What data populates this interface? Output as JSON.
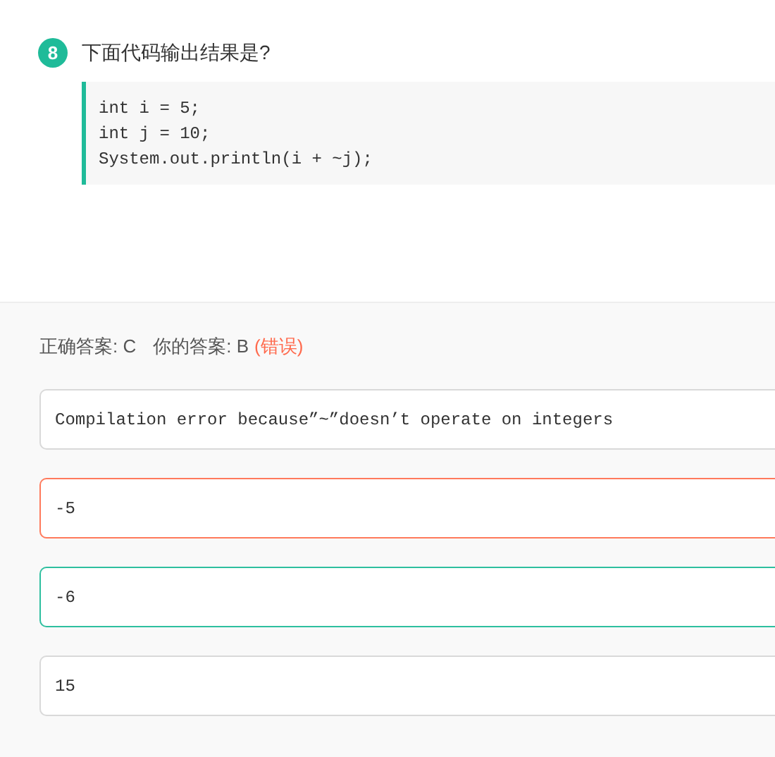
{
  "question": {
    "number": "8",
    "title": "下面代码输出结果是?",
    "code": [
      "int i = 5;",
      "int j = 10;",
      "System.out.println(i + ~j);"
    ]
  },
  "result": {
    "correct_answer": "正确答案: C",
    "your_answer": "你的答案: B",
    "verdict": "(错误)"
  },
  "options": [
    {
      "text": "Compilation error because”~”doesn’t operate on integers",
      "color": "#d9d9d9"
    },
    {
      "text": "-5",
      "color": "#ff7a5c"
    },
    {
      "text": "-6",
      "color": "#2ebf9f"
    },
    {
      "text": "15",
      "color": "#d9d9d9"
    }
  ]
}
